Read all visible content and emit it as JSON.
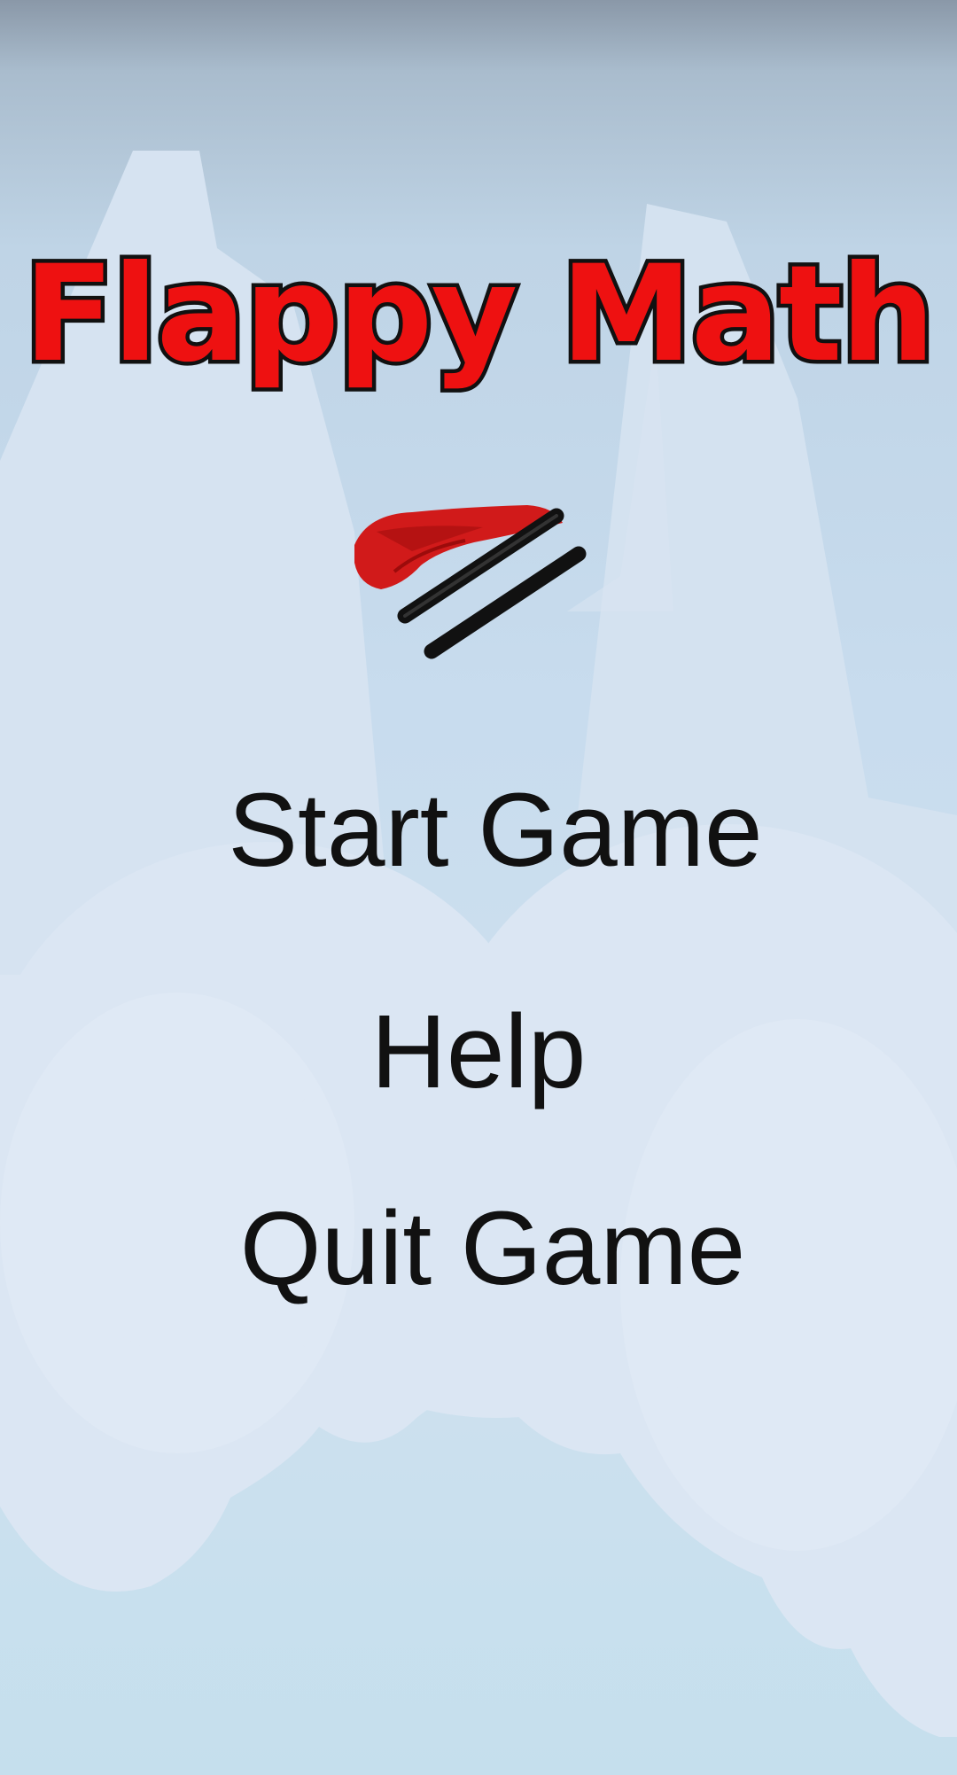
{
  "game": {
    "title": "Flappy Math"
  },
  "menu": {
    "start_label": "Start Game",
    "help_label": "Help",
    "quit_label": "Quit Game"
  },
  "colors": {
    "title_fill": "#ee1111",
    "title_outline": "#111111",
    "menu_text": "#111111",
    "sky": "#c8dcee",
    "mountains": "#d9e6f3",
    "clouds": "#dce8f4"
  },
  "icons": {
    "mascot": "flying-red-cape-equals-sign"
  }
}
